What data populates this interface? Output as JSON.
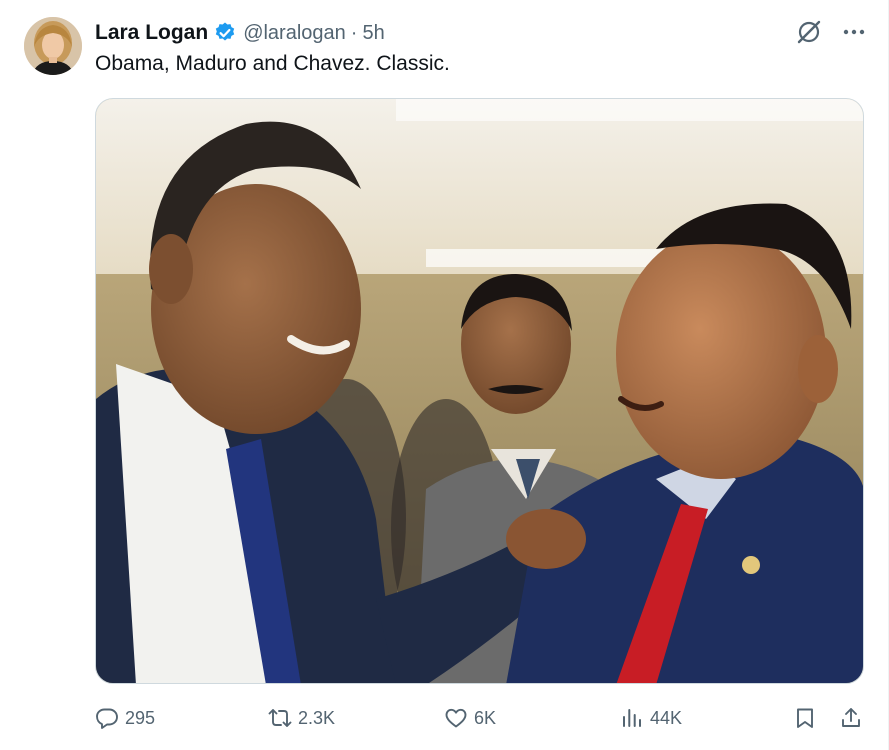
{
  "tweet": {
    "author": {
      "display_name": "Lara Logan",
      "handle": "@laralogan",
      "verified": true,
      "verified_color": "#1d9bf0"
    },
    "separator": "·",
    "timestamp": "5h",
    "text": "Obama, Maduro and Chavez. Classic.",
    "media_icon": "photo"
  },
  "metrics": {
    "replies": "295",
    "retweets": "2.3K",
    "likes": "6K",
    "views": "44K"
  },
  "icons": {
    "reply": "reply-icon",
    "retweet": "retweet-icon",
    "like": "heart-icon",
    "views": "analytics-icon",
    "bookmark": "bookmark-icon",
    "share": "share-icon",
    "grok": "grok-icon",
    "more": "more-icon"
  },
  "colors": {
    "text_primary": "#0f1419",
    "text_secondary": "#536471",
    "accent": "#1d9bf0"
  }
}
